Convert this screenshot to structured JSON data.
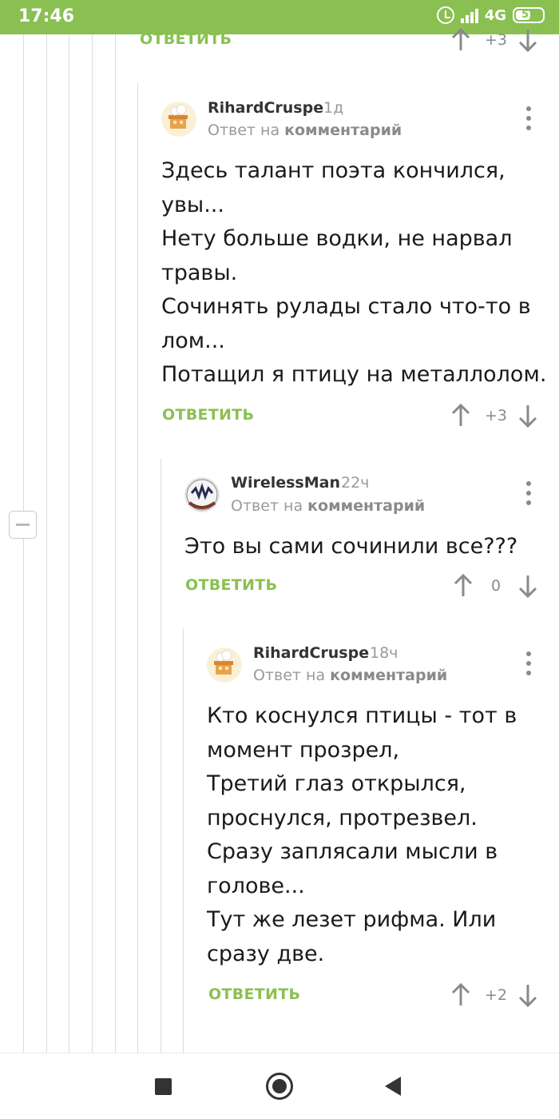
{
  "status": {
    "time": "17:46",
    "network": "4G",
    "battery": "51",
    "icons": [
      "alarm-icon",
      "signal-icon",
      "battery-icon"
    ]
  },
  "accent_color": "#8ac052",
  "top_action": {
    "reply": "ОТВЕТИТЬ",
    "score": "+3"
  },
  "comments": [
    {
      "author": "RihardCruspe",
      "time": "1д",
      "reply_prefix": "Ответ на",
      "reply_target": "комментарий",
      "lines": [
        "Здесь талант поэта кончился,",
        "увы...",
        "Нету больше водки, не нарвал",
        "травы.",
        "Сочинять рулады стало что-то в",
        "лом...",
        "Потащил я птицу на металлолом."
      ],
      "reply": "ОТВЕТИТЬ",
      "score": "+3"
    },
    {
      "author": "WirelessMan",
      "time": "22ч",
      "reply_prefix": "Ответ на",
      "reply_target": "комментарий",
      "lines": [
        "Это вы сами сочинили все???"
      ],
      "reply": "ОТВЕТИТЬ",
      "score": "0"
    },
    {
      "author": "RihardCruspe",
      "time": "18ч",
      "reply_prefix": "Ответ на",
      "reply_target": "комментарий",
      "lines": [
        "Кто коснулся птицы - тот в",
        "момент прозрел,",
        "Третий глаз открылся,",
        "проснулся, протрезвел.",
        "Сразу заплясали мысли в",
        "голове...",
        "Тут же лезет рифма. Или",
        "сразу две."
      ],
      "reply": "ОТВЕТИТЬ",
      "score": "+2"
    }
  ]
}
